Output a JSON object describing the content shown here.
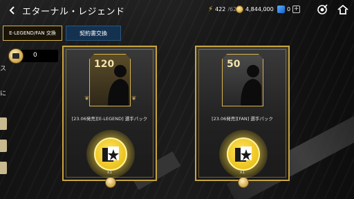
{
  "header": {
    "title": "エターナル・レジェンド",
    "stamina": "422",
    "stamina_max": "/62",
    "coins": "4,844,000",
    "gems": "0"
  },
  "tabs": {
    "elegend_fan": "E-LEGEND/FAN 交換",
    "contract": "契約書交換"
  },
  "token": {
    "count": "0"
  },
  "side_chars": [
    "ス",
    "に"
  ],
  "cards": [
    {
      "ovr": "120",
      "name": "[23.06発売][E-LEGEND] 選手パック",
      "qty": "x1"
    },
    {
      "ovr": "50",
      "name": "[23.06発売][FAN] 選手パック",
      "qty": "x1"
    }
  ],
  "colors": {
    "gold": "#c9a53c",
    "tab_blue": "#14324f",
    "pack_yellow": "#ffe561"
  }
}
